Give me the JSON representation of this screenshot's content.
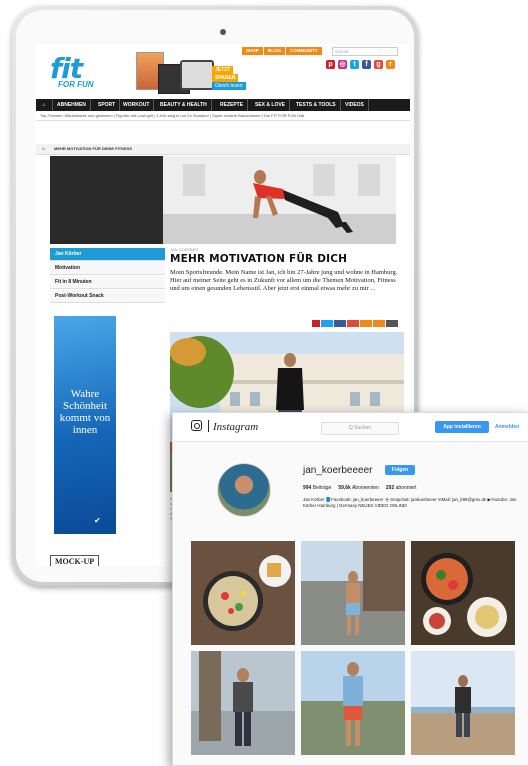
{
  "website": {
    "logo_text": "fit",
    "logo_sub": "FOR FUN",
    "promo_tags": [
      "JETZT",
      "SPAREN",
      "Gleich lesen"
    ],
    "top_links": [
      "SHOP",
      "BLOG",
      "COMMUNITY"
    ],
    "search_placeholder": "SUCHE",
    "nav_items": [
      "ABNEHMEN",
      "SPORT",
      "WORKOUT",
      "BEAUTY & HEALTH",
      "REZEPTE",
      "SEX & LOVE",
      "TESTS & TOOLS",
      "VIDEOS"
    ],
    "top_themes": "Top-Themen: Milchshakes und gewinnen | Figuren mit LowLight | 2-Kilo weg in nur 24 Stunden! | Super scharfe Bauchtrainer | Die FIT FOR FUN Diät",
    "breadcrumb": "MEHR MOTIVATION FÜR DEINE FITNESS",
    "sidebar": [
      "Jan Körber",
      "Motivation",
      "Fit in 8 Minuten",
      "Post-Workout Snack"
    ],
    "ad_text": "Wahre Schönheit kommt von innen",
    "kicker": "JAN KOERBER",
    "headline": "MEHR MOTIVATION FÜR DICH",
    "lead": "Moin Sportsfreunde. Mein Name ist Jan, ich bin 27-Jahre jung und wohne in Hamburg. Hier auf meiner Seite geht es in Zukunft vor allem um die Themen Motivation, Fitness und um einen gesunden Lebensstil. Aber jetzt erst einmal etwas mehr zu mir ...",
    "mockup_label": "MOCK-UP",
    "colors": {
      "brand": "#1e9bd7",
      "accent": "#f08a16",
      "nav": "#1a1a1a"
    }
  },
  "instagram": {
    "logo": "Instagram",
    "search_placeholder": "Q Suchen",
    "app_button": "App installieren",
    "login": "Anmelden",
    "username": "jan_koerbeeeer",
    "follow_button": "Folgen",
    "stats": {
      "posts": "994",
      "posts_label": "Beiträge",
      "followers": "59,6k",
      "followers_label": "Abonnenten",
      "following": "292",
      "following_label": "abonniert"
    },
    "bio": "Jan Körber 📘Facebook: jan_koerbeeeer 👻Snapchat: jankoerbeeer ✉Mail: jan_k89@gmx.de ▶Youtube: Jan Körber Hamburg | Germany NEUES VIDEO ONLINE!",
    "accent_color": "#3897f0"
  }
}
